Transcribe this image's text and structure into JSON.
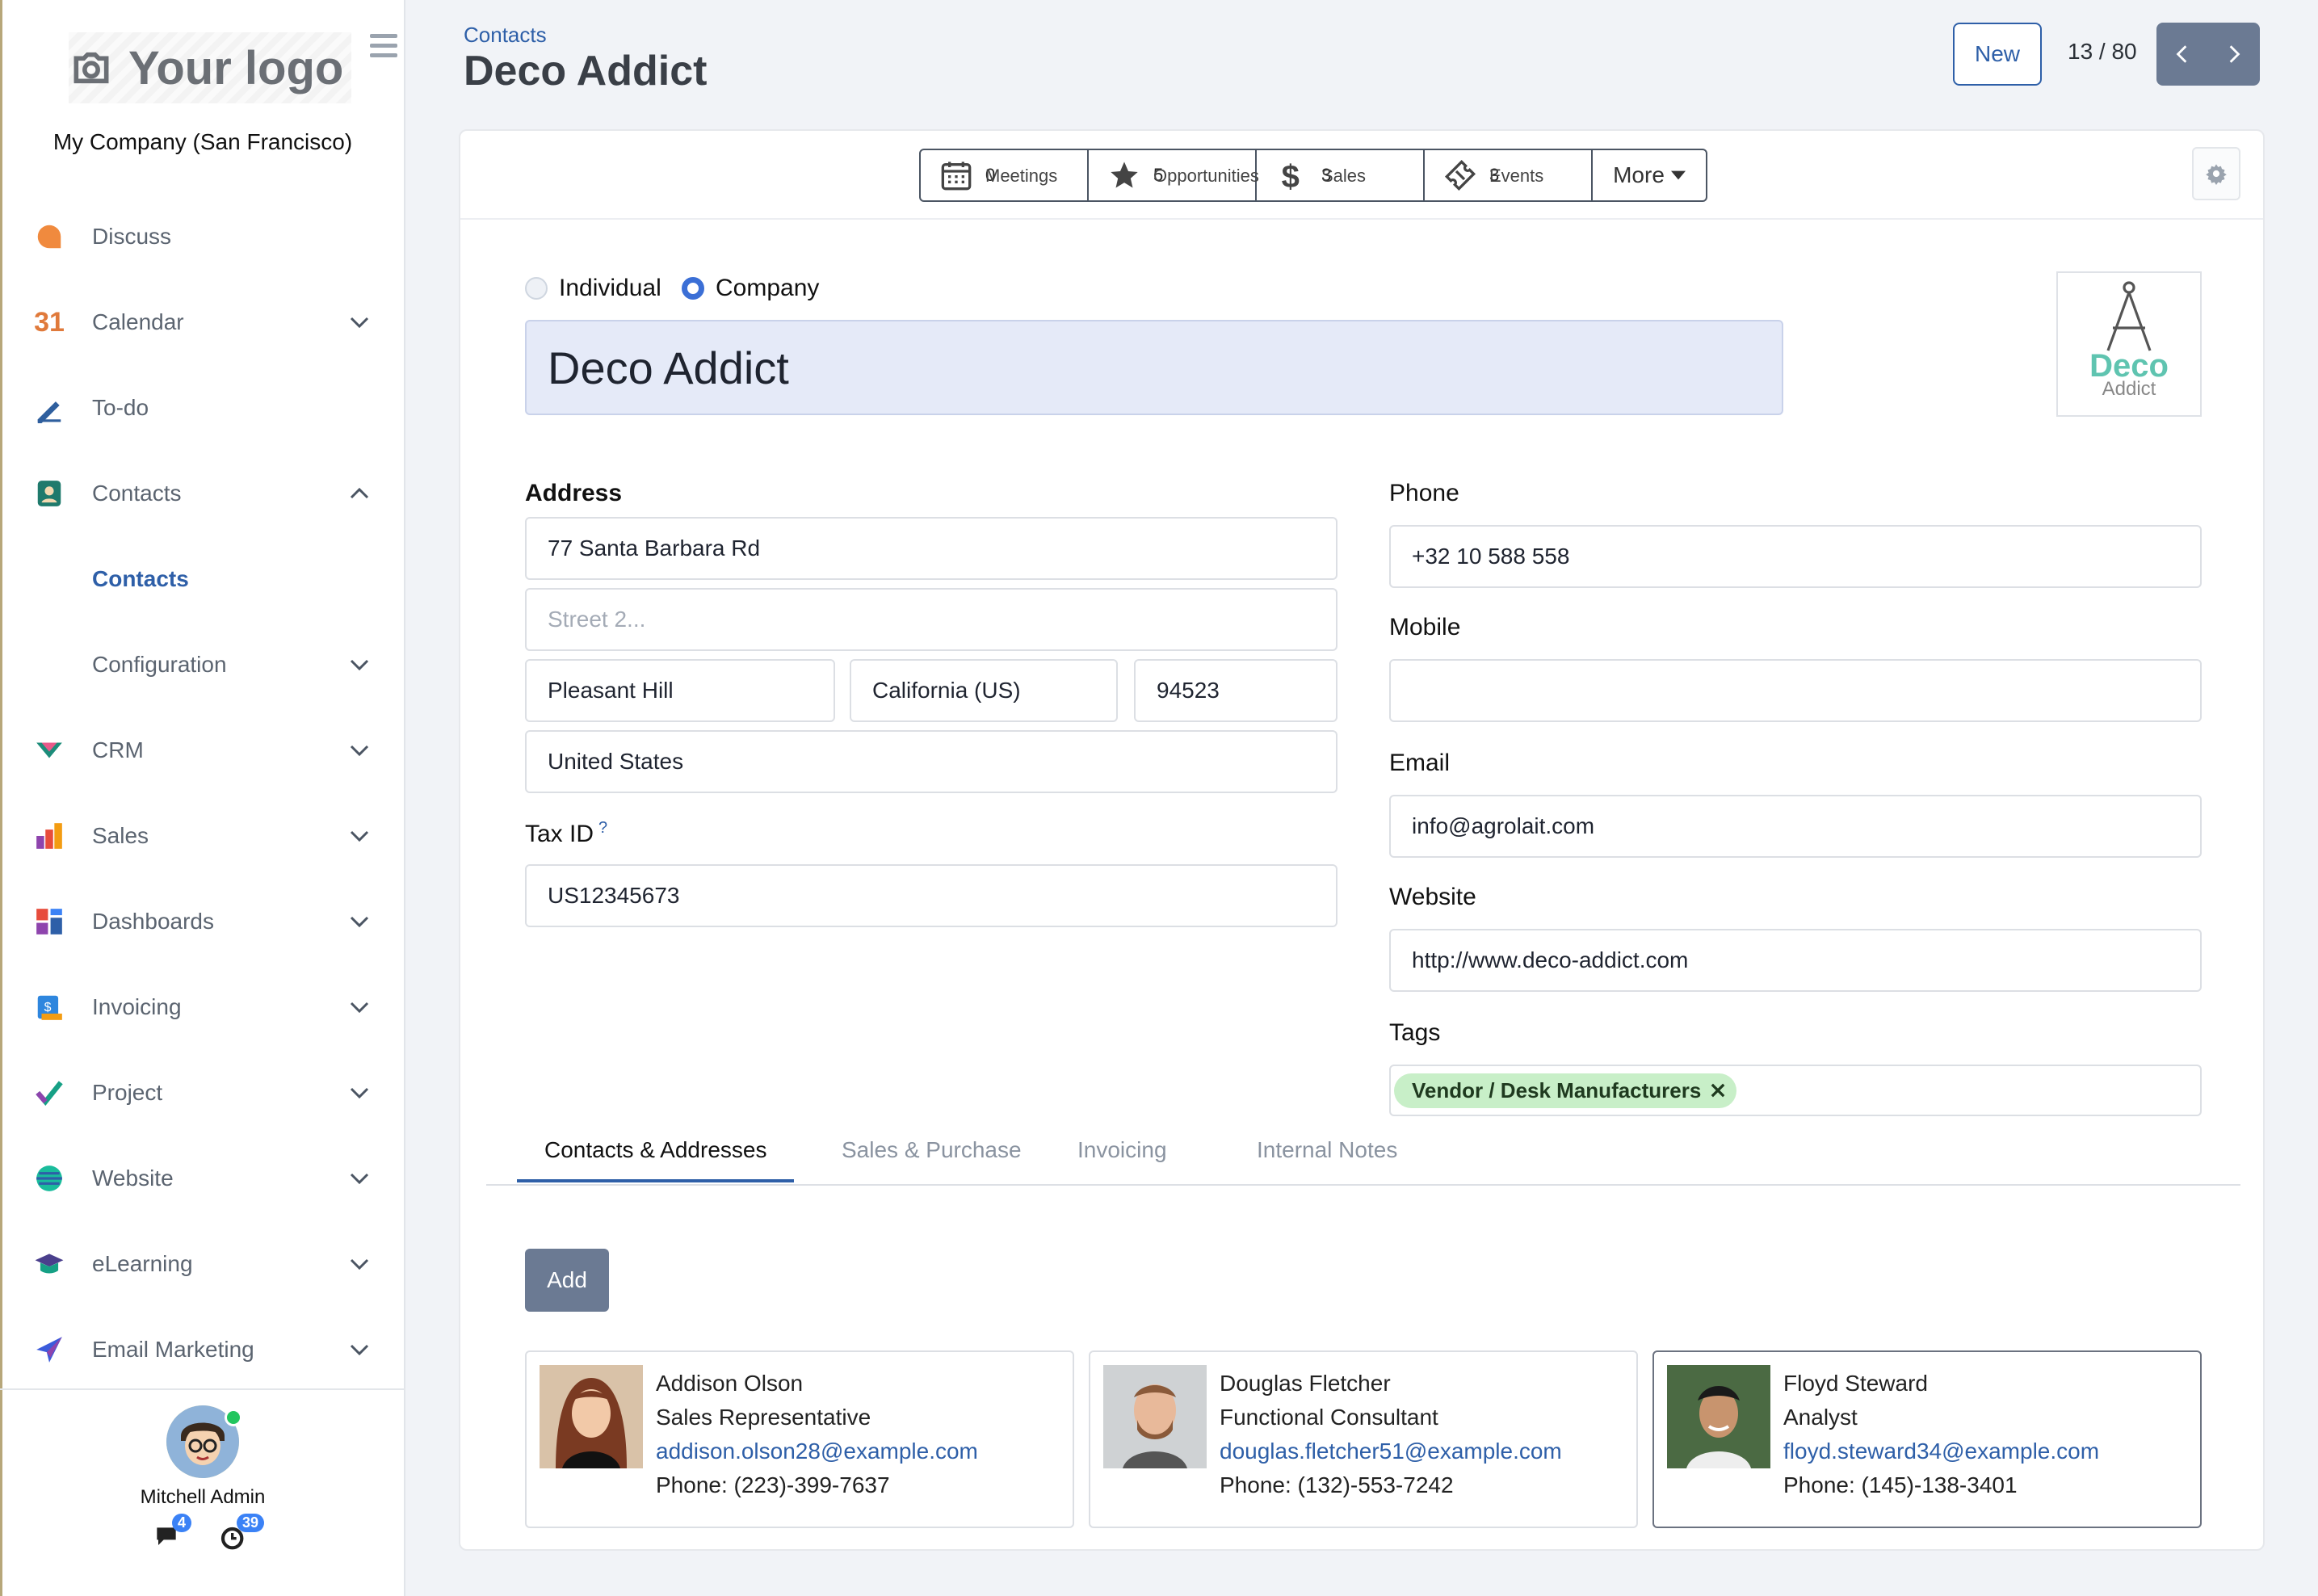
{
  "sidebar": {
    "logo_text": "Your logo",
    "company": "My Company (San Francisco)",
    "items": [
      {
        "label": "Discuss",
        "icon": "discuss-icon",
        "expand": ""
      },
      {
        "label": "Calendar",
        "icon": "calendar-icon",
        "expand": "down"
      },
      {
        "label": "To-do",
        "icon": "todo-icon",
        "expand": ""
      },
      {
        "label": "Contacts",
        "icon": "contacts-icon",
        "expand": "up"
      },
      {
        "label": "Contacts",
        "icon": "",
        "expand": "",
        "sub": true,
        "active": true
      },
      {
        "label": "Configuration",
        "icon": "",
        "expand": "down",
        "sub": true
      },
      {
        "label": "CRM",
        "icon": "crm-icon",
        "expand": "down"
      },
      {
        "label": "Sales",
        "icon": "sales-icon",
        "expand": "down"
      },
      {
        "label": "Dashboards",
        "icon": "dashboards-icon",
        "expand": "down"
      },
      {
        "label": "Invoicing",
        "icon": "invoicing-icon",
        "expand": "down"
      },
      {
        "label": "Project",
        "icon": "project-icon",
        "expand": "down"
      },
      {
        "label": "Website",
        "icon": "website-icon",
        "expand": "down"
      },
      {
        "label": "eLearning",
        "icon": "elearning-icon",
        "expand": "down"
      },
      {
        "label": "Email Marketing",
        "icon": "email-marketing-icon",
        "expand": "down"
      }
    ],
    "user": {
      "name": "Mitchell Admin",
      "messages": "4",
      "activities": "39"
    }
  },
  "header": {
    "breadcrumb": "Contacts",
    "title": "Deco Addict",
    "new_label": "New",
    "pager": "13 / 80"
  },
  "smart_buttons": [
    {
      "label": "Meetings",
      "value": "0",
      "icon": "calendar-grid-icon"
    },
    {
      "label": "Opportunities",
      "value": "5",
      "icon": "star-icon"
    },
    {
      "label": "Sales",
      "value": "3",
      "icon": "dollar-icon"
    },
    {
      "label": "Events",
      "value": "3",
      "icon": "ticket-icon"
    }
  ],
  "more_label": "More",
  "form": {
    "type_individual": "Individual",
    "type_company": "Company",
    "name": "Deco Addict",
    "logo": {
      "line1": "Deco",
      "line2": "Addict"
    },
    "address_label": "Address",
    "street": "77 Santa Barbara Rd",
    "street2_placeholder": "Street 2...",
    "city": "Pleasant Hill",
    "state": "California (US)",
    "zip": "94523",
    "country": "United States",
    "taxid_label": "Tax ID",
    "taxid_help": "?",
    "taxid": "US12345673",
    "phone_label": "Phone",
    "phone": "+32 10 588 558",
    "mobile_label": "Mobile",
    "mobile": "",
    "email_label": "Email",
    "email": "info@agrolait.com",
    "website_label": "Website",
    "website": "http://www.deco-addict.com",
    "tags_label": "Tags",
    "tag": "Vendor / Desk Manufacturers"
  },
  "tabs": [
    "Contacts & Addresses",
    "Sales & Purchase",
    "Invoicing",
    "Internal Notes"
  ],
  "add_label": "Add",
  "contacts": [
    {
      "name": "Addison Olson",
      "role": "Sales Representative",
      "email": "addison.olson28@example.com",
      "phone": "Phone: (223)-399-7637"
    },
    {
      "name": "Douglas Fletcher",
      "role": "Functional Consultant",
      "email": "douglas.fletcher51@example.com",
      "phone": "Phone: (132)-553-7242"
    },
    {
      "name": "Floyd Steward",
      "role": "Analyst",
      "email": "floyd.steward34@example.com",
      "phone": "Phone: (145)-138-3401"
    }
  ]
}
